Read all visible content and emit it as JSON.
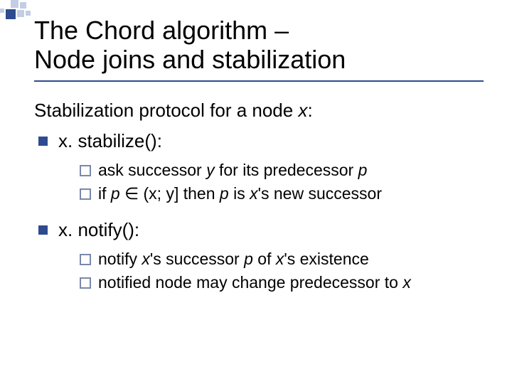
{
  "title_line1": "The Chord algorithm –",
  "title_line2": "Node joins and stabilization",
  "lead_pre": "Stabilization protocol for a node ",
  "lead_var": "x",
  "lead_post": ":",
  "stabilize": {
    "label": "x. stabilize():"
  },
  "stab_items": [
    {
      "pre": "ask successor ",
      "i1": "y",
      "mid1": " for its predecessor ",
      "i2": "p",
      "post": ""
    },
    {
      "pre": "if ",
      "i1": "p",
      "mid1": " ∈ (x; y] then ",
      "i2": "p",
      "mid2": " is ",
      "i3": "x",
      "post": "'s new successor"
    }
  ],
  "notify": {
    "label": "x. notify():"
  },
  "notify_items": [
    {
      "pre": "notify ",
      "i1": "x",
      "mid1": "'s successor ",
      "i2": "p",
      "mid2": " of ",
      "i3": "x",
      "post": "'s existence"
    },
    {
      "pre": "notified node may change predecessor to ",
      "i1": "x",
      "post": ""
    }
  ]
}
